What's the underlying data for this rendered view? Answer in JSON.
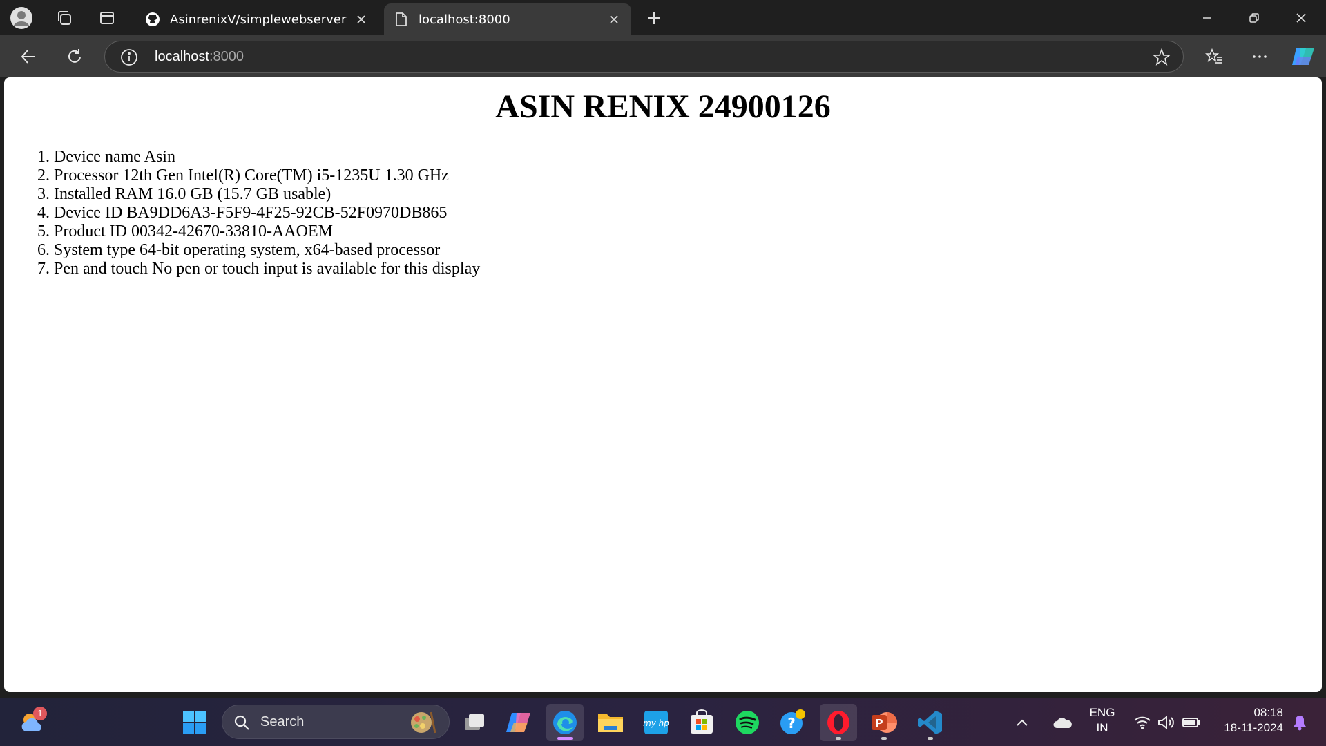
{
  "browser": {
    "tabs": [
      {
        "title": "AsinrenixV/simplewebserver",
        "favicon": "github-icon",
        "active": false
      },
      {
        "title": "localhost:8000",
        "favicon": "page-icon",
        "active": true
      }
    ],
    "address": {
      "host": "localhost",
      "port": ":8000"
    }
  },
  "page": {
    "heading": "ASIN RENIX 24900126",
    "items": [
      {
        "num": "1.",
        "text": "Device name Asin"
      },
      {
        "num": "2.",
        "text": "Processor 12th Gen Intel(R) Core(TM) i5-1235U 1.30 GHz"
      },
      {
        "num": "3.",
        "text": "Installed RAM 16.0 GB (15.7 GB usable)"
      },
      {
        "num": "4.",
        "text": "Device ID BA9DD6A3-F5F9-4F25-92CB-52F0970DB865"
      },
      {
        "num": "5.",
        "text": "Product ID 00342-42670-33810-AAOEM"
      },
      {
        "num": "6.",
        "text": "System type 64-bit operating system, x64-based processor"
      },
      {
        "num": "7.",
        "text": "Pen and touch No pen or touch input is available for this display"
      }
    ]
  },
  "taskbar": {
    "weather_badge": "1",
    "search_label": "Search",
    "tray": {
      "lang_line1": "ENG",
      "lang_line2": "IN",
      "time": "08:18",
      "date": "18-11-2024"
    }
  },
  "colors": {
    "tabstrip_bg": "#1f1f1f",
    "toolbar_bg": "#3a3a3a",
    "page_bg": "#ffffff",
    "taskbar_accent": "#d48cff"
  }
}
